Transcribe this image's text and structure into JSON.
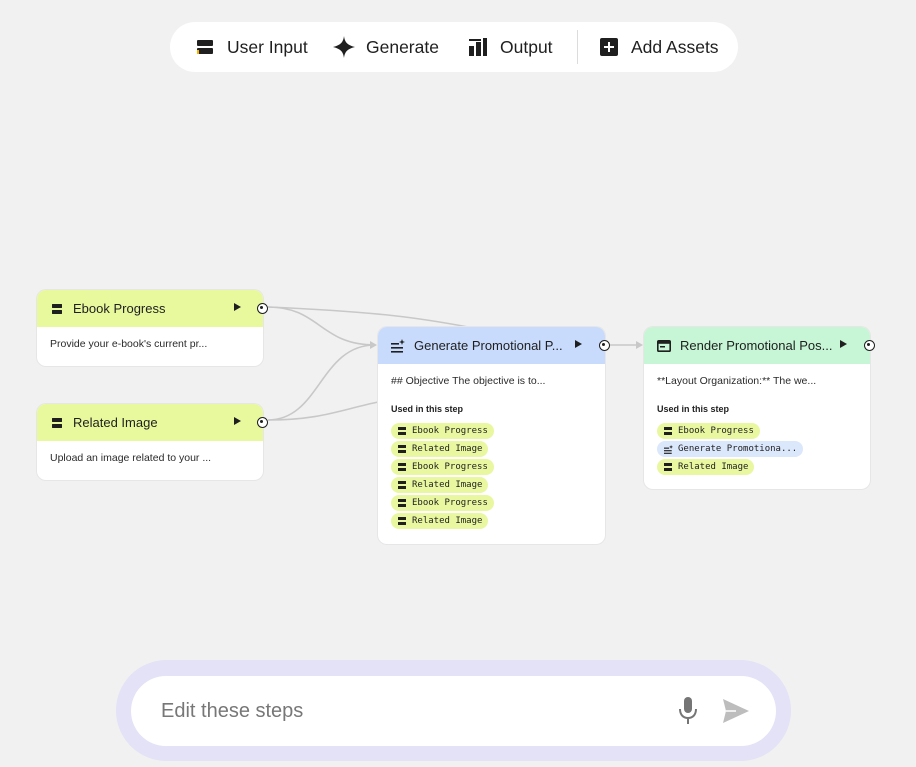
{
  "toolbar": {
    "items": [
      {
        "label": "User Input",
        "icon": "user-input-icon"
      },
      {
        "label": "Generate",
        "icon": "sparkle-icon"
      },
      {
        "label": "Output",
        "icon": "output-icon"
      },
      {
        "label": "Add Assets",
        "icon": "add-box-icon"
      }
    ]
  },
  "nodes": {
    "ebook": {
      "title": "Ebook Progress",
      "description": "Provide your e-book's current pr..."
    },
    "image": {
      "title": "Related Image",
      "description": "Upload an image related to your ..."
    },
    "generate": {
      "title": "Generate Promotional P...",
      "description": "## Objective The objective is to...",
      "used_label": "Used in this step",
      "chips": [
        "Ebook Progress",
        "Related Image",
        "Ebook Progress",
        "Related Image",
        "Ebook Progress",
        "Related Image"
      ]
    },
    "render": {
      "title": "Render Promotional Pos...",
      "description": "**Layout Organization:** The we...",
      "used_label": "Used in this step",
      "chips": [
        "Ebook Progress",
        "Generate Promotiona...",
        "Related Image"
      ]
    }
  },
  "edit_bar": {
    "placeholder": "Edit these steps"
  },
  "colors": {
    "input_node": "#e8f99d",
    "generate_node": "#c9dbfc",
    "output_node": "#c6f6d5",
    "edit_ring": "#e3e2f6"
  }
}
